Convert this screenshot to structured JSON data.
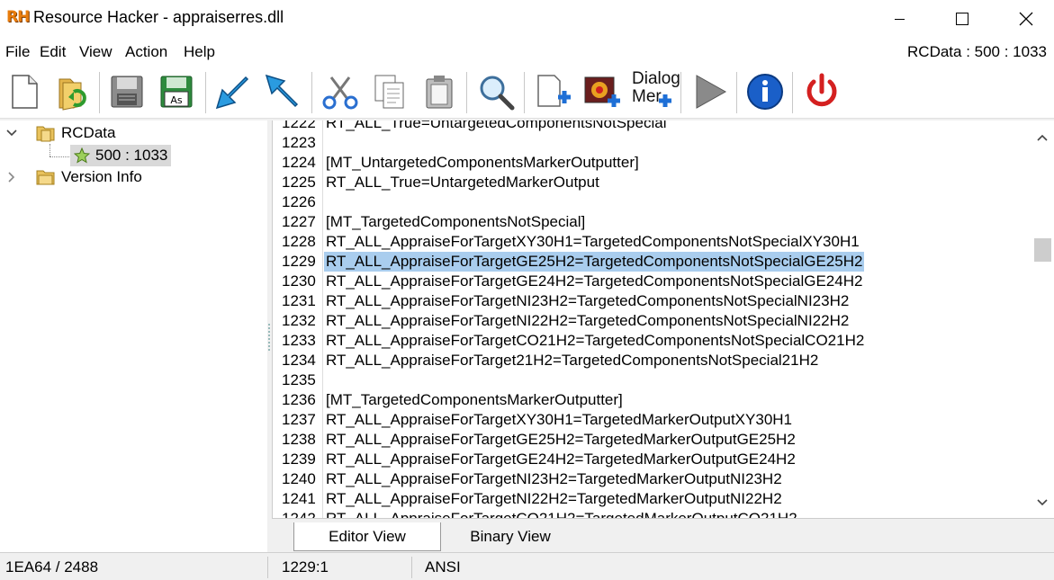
{
  "window": {
    "logo_text": "RH",
    "title": "Resource Hacker - appraiserres.dll"
  },
  "menu": {
    "items": [
      "File",
      "Edit",
      "View",
      "Action",
      "Help"
    ],
    "rcdata_indicator": "RCData : 500 : 1033"
  },
  "toolbar": {
    "dialog_menu_label_1": "Dialog",
    "dialog_menu_label_2": "Mer"
  },
  "tree": {
    "root_label": "RCData",
    "child_label": "500 : 1033",
    "sibling_label": "Version Info"
  },
  "editor": {
    "partial_top": "RT_ALL_True=UntargetedComponentsNotSpecial",
    "lines": [
      {
        "n": "1223",
        "text": ""
      },
      {
        "n": "1224",
        "text": "[MT_UntargetedComponentsMarkerOutputter]"
      },
      {
        "n": "1225",
        "text": "RT_ALL_True=UntargetedMarkerOutput"
      },
      {
        "n": "1226",
        "text": ""
      },
      {
        "n": "1227",
        "text": "[MT_TargetedComponentsNotSpecial]"
      },
      {
        "n": "1228",
        "text": "RT_ALL_AppraiseForTargetXY30H1=TargetedComponentsNotSpecialXY30H1"
      },
      {
        "n": "1229",
        "text": "RT_ALL_AppraiseForTargetGE25H2=TargetedComponentsNotSpecialGE25H2"
      },
      {
        "n": "1230",
        "text": "RT_ALL_AppraiseForTargetGE24H2=TargetedComponentsNotSpecialGE24H2"
      },
      {
        "n": "1231",
        "text": "RT_ALL_AppraiseForTargetNI23H2=TargetedComponentsNotSpecialNI23H2"
      },
      {
        "n": "1232",
        "text": "RT_ALL_AppraiseForTargetNI22H2=TargetedComponentsNotSpecialNI22H2"
      },
      {
        "n": "1233",
        "text": "RT_ALL_AppraiseForTargetCO21H2=TargetedComponentsNotSpecialCO21H2"
      },
      {
        "n": "1234",
        "text": "RT_ALL_AppraiseForTarget21H2=TargetedComponentsNotSpecial21H2"
      },
      {
        "n": "1235",
        "text": ""
      },
      {
        "n": "1236",
        "text": "[MT_TargetedComponentsMarkerOutputter]"
      },
      {
        "n": "1237",
        "text": "RT_ALL_AppraiseForTargetXY30H1=TargetedMarkerOutputXY30H1"
      },
      {
        "n": "1238",
        "text": "RT_ALL_AppraiseForTargetGE25H2=TargetedMarkerOutputGE25H2"
      },
      {
        "n": "1239",
        "text": "RT_ALL_AppraiseForTargetGE24H2=TargetedMarkerOutputGE24H2"
      },
      {
        "n": "1240",
        "text": "RT_ALL_AppraiseForTargetNI23H2=TargetedMarkerOutputNI23H2"
      },
      {
        "n": "1241",
        "text": "RT_ALL_AppraiseForTargetNI22H2=TargetedMarkerOutputNI22H2"
      }
    ],
    "highlighted_line": "1229",
    "partial_top_number": "1222",
    "partial_bottom_number": "1242",
    "partial_bottom": "RT_ALL_AppraiseForTargetCO21H2=TargetedMarkerOutputCO21H2"
  },
  "tabs": {
    "editor_view": "Editor View",
    "binary_view": "Binary View"
  },
  "status": {
    "offset": "1EA64 / 2488",
    "position": "1229:1",
    "encoding": "ANSI"
  },
  "colors": {
    "highlight": "#a9cdee",
    "logo": "#e87c0c"
  }
}
